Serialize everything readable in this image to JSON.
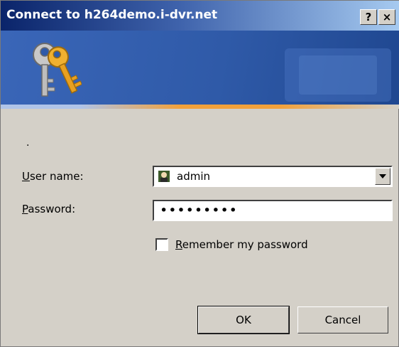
{
  "window": {
    "title": "Connect to h264demo.i-dvr.net",
    "help_button": "?",
    "close_button": "×"
  },
  "form": {
    "prompt": ".",
    "username_label_accel": "U",
    "username_label_rest": "ser name:",
    "username_value": "admin",
    "password_label_accel": "P",
    "password_label_rest": "assword:",
    "password_value": "•••••••••",
    "remember_label_accel": "R",
    "remember_label_rest": "emember my password",
    "remember_checked": false
  },
  "buttons": {
    "ok": "OK",
    "cancel": "Cancel"
  },
  "icons": {
    "banner": "keys-icon",
    "user": "user-icon",
    "dropdown": "chevron-down-icon"
  },
  "colors": {
    "titlebar_start": "#0a246a",
    "titlebar_end": "#a6caf0",
    "banner": "#2f5aa8",
    "accent": "#f2a13a",
    "dialog_bg": "#d4d0c8"
  }
}
